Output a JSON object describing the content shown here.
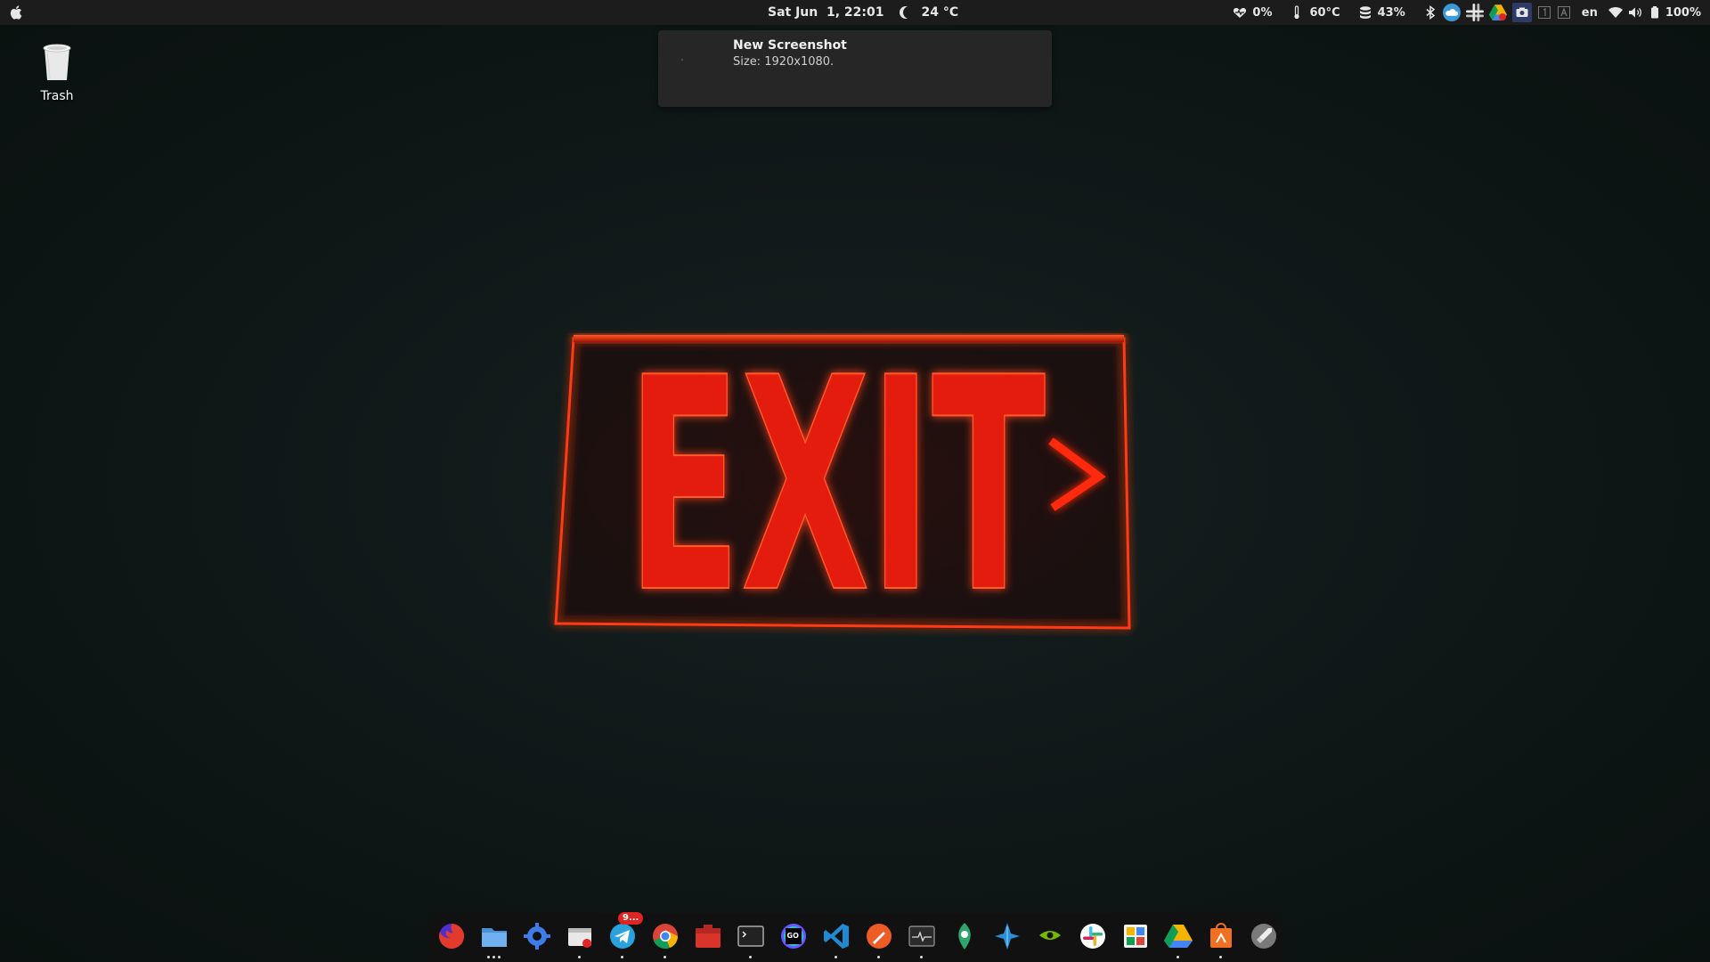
{
  "topbar": {
    "datetime": "Sat Jun  1, 22:01",
    "weather": "24 °C",
    "tray": {
      "cpu": "0%",
      "temp": "60°C",
      "disk": "43%",
      "lang": "en",
      "battery": "100%"
    }
  },
  "notification": {
    "title": "New Screenshot",
    "body": "Size: 1920x1080."
  },
  "desktop": {
    "trash_label": "Trash"
  },
  "wallpaper": {
    "sign_text": "EXIT",
    "sign_color": "#ff2a10"
  },
  "dock": {
    "items": [
      {
        "name": "firefox",
        "running": false
      },
      {
        "name": "files",
        "running": true,
        "windows": 3
      },
      {
        "name": "settings",
        "running": false
      },
      {
        "name": "screenshot",
        "running": true
      },
      {
        "name": "telegram",
        "running": true,
        "badge": "9..."
      },
      {
        "name": "chrome",
        "running": true
      },
      {
        "name": "toolbox",
        "running": false
      },
      {
        "name": "terminal",
        "running": true
      },
      {
        "name": "goland",
        "running": false
      },
      {
        "name": "vscode",
        "running": true
      },
      {
        "name": "postman",
        "running": true
      },
      {
        "name": "system-monitor",
        "running": true
      },
      {
        "name": "kde-connect",
        "running": false
      },
      {
        "name": "maya",
        "running": false
      },
      {
        "name": "nvidia",
        "running": false
      },
      {
        "name": "slack",
        "running": false
      },
      {
        "name": "image-viewer",
        "running": false
      },
      {
        "name": "google-drive",
        "running": true
      },
      {
        "name": "ubuntu-software",
        "running": true
      },
      {
        "name": "launcher",
        "running": false
      }
    ]
  },
  "colors": {
    "topbar_bg": "#1c1c1c",
    "dock_bg": "#111111",
    "notification_bg": "#262626",
    "desktop_bg": "#0f1716"
  }
}
